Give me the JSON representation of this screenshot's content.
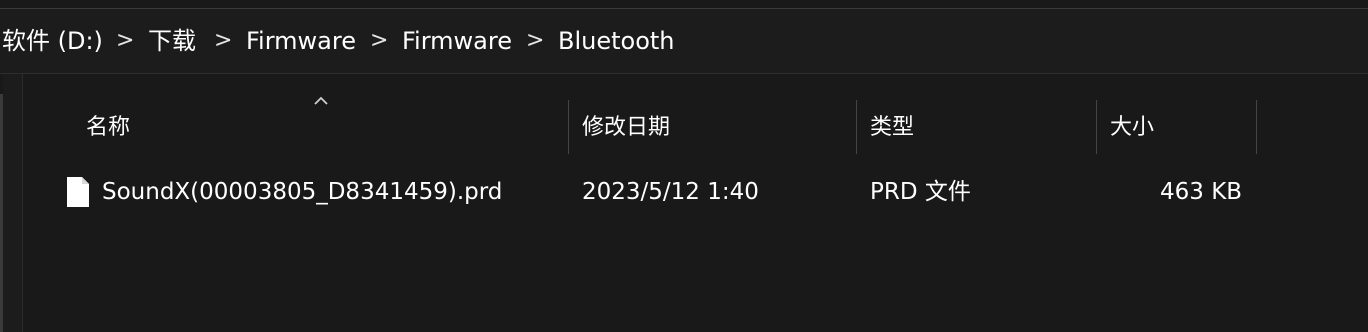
{
  "breadcrumb": {
    "items": [
      "软件 (D:)",
      "下载",
      "Firmware",
      "Firmware",
      "Bluetooth"
    ],
    "separator": ">"
  },
  "columns": {
    "name": "名称",
    "modified": "修改日期",
    "type": "类型",
    "size": "大小"
  },
  "files": [
    {
      "name": "SoundX(00003805_D8341459).prd",
      "modified": "2023/5/12 1:40",
      "type": "PRD 文件",
      "size": "463 KB",
      "icon": "file-icon"
    }
  ],
  "sort": {
    "column": "name",
    "direction": "ascending",
    "icon": "chevron-up-icon"
  },
  "colors": {
    "background": "#191919",
    "text": "#ffffff",
    "divider": "#454545"
  }
}
